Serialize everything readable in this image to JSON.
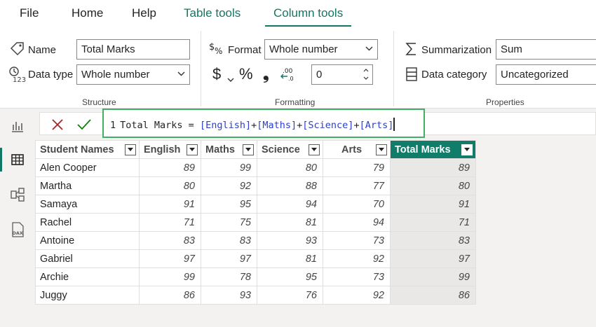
{
  "menu": {
    "tabs": [
      {
        "label": "File"
      },
      {
        "label": "Home"
      },
      {
        "label": "Help"
      },
      {
        "label": "Table tools"
      },
      {
        "label": "Column tools"
      }
    ]
  },
  "ribbon": {
    "structure": {
      "title": "Structure",
      "name_label": "Name",
      "name_value": "Total Marks",
      "datatype_label": "Data type",
      "datatype_value": "Whole number"
    },
    "formatting": {
      "title": "Formatting",
      "format_label": "Format",
      "format_value": "Whole number",
      "currency_symbol": "$",
      "percent_symbol": "%",
      "comma_symbol": "❟",
      "decimals_value": "0"
    },
    "properties": {
      "title": "Properties",
      "summarization_label": "Summarization",
      "summarization_value": "Sum",
      "category_label": "Data category",
      "category_value": "Uncategorized"
    }
  },
  "formula": {
    "line_number": "1",
    "prefix": "Total Marks = ",
    "terms": [
      "[English]",
      "[Maths]",
      "[Science]",
      "[Arts]"
    ],
    "operator": "+"
  },
  "table": {
    "columns": [
      "Student Names",
      "English",
      "Maths",
      "Science",
      "Arts",
      "Total Marks"
    ],
    "rows": [
      [
        "Alen Cooper",
        "89",
        "99",
        "80",
        "79",
        "89"
      ],
      [
        "Martha",
        "80",
        "92",
        "88",
        "77",
        "80"
      ],
      [
        "Samaya",
        "91",
        "95",
        "94",
        "70",
        "91"
      ],
      [
        "Rachel",
        "71",
        "75",
        "81",
        "94",
        "71"
      ],
      [
        "Antoine",
        "83",
        "83",
        "93",
        "73",
        "83"
      ],
      [
        "Gabriel",
        "97",
        "97",
        "81",
        "92",
        "97"
      ],
      [
        "Archie",
        "99",
        "78",
        "95",
        "73",
        "99"
      ],
      [
        "Juggy",
        "86",
        "93",
        "76",
        "92",
        "86"
      ]
    ]
  },
  "colors": {
    "accent": "#117865",
    "selected_header": "#107c6a",
    "formula_border": "#3fb065"
  }
}
